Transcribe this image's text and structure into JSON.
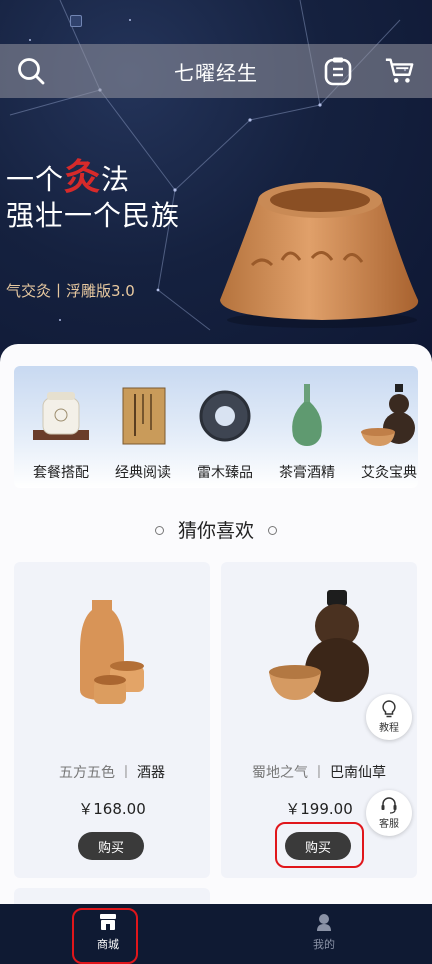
{
  "app": {
    "title": "七曜经生"
  },
  "header": {
    "left_icon": "search-icon",
    "right_icons": [
      "clipboard-icon",
      "cart-icon"
    ]
  },
  "banner": {
    "line1_prefix": "一个",
    "line1_accent": "灸",
    "line1_suffix": "法",
    "line2": "强壮一个民族",
    "subtitle": "气交灸丨浮雕版3.0"
  },
  "categories": [
    {
      "label": "套餐搭配",
      "icon": "jar-set-icon"
    },
    {
      "label": "经典阅读",
      "icon": "book-icon"
    },
    {
      "label": "雷木臻品",
      "icon": "wood-ring-icon"
    },
    {
      "label": "茶膏酒精",
      "icon": "vase-icon"
    },
    {
      "label": "艾灸宝典",
      "icon": "gourd-icon"
    }
  ],
  "section": {
    "title": "猜你喜欢"
  },
  "products": [
    {
      "name_prefix": "五方五色",
      "sep": "丨",
      "name": "酒器",
      "price": "￥168.00",
      "buy_label": "购买"
    },
    {
      "name_prefix": "蜀地之气",
      "sep": "丨",
      "name": "巴南仙草",
      "price": "￥199.00",
      "buy_label": "购买"
    }
  ],
  "float_buttons": [
    {
      "label": "教程",
      "icon": "lightbulb-icon"
    },
    {
      "label": "客服",
      "icon": "headset-icon"
    }
  ],
  "nav": [
    {
      "label": "商城",
      "icon": "store-icon",
      "active": true
    },
    {
      "label": "我的",
      "icon": "user-icon",
      "active": false
    }
  ],
  "colors": {
    "accent_red": "#d72a2a",
    "nav_bg": "#0f1a33",
    "highlight": "#e0161b"
  }
}
